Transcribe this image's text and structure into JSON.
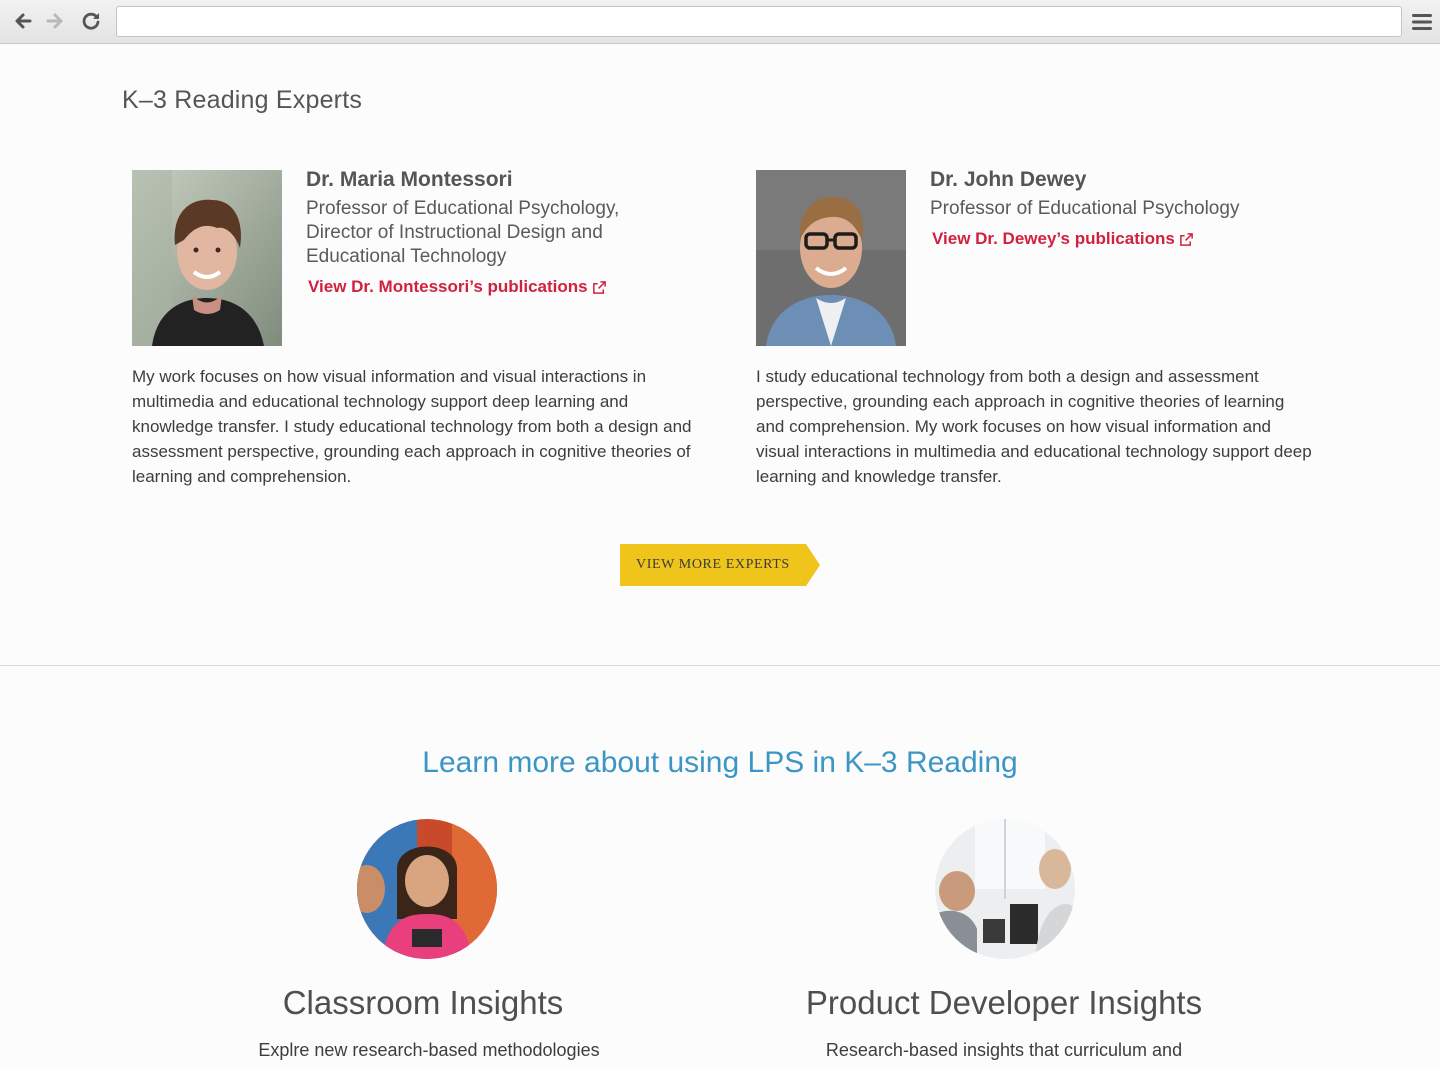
{
  "browser": {
    "url": ""
  },
  "section": {
    "title": "K–3 Reading Experts"
  },
  "experts": [
    {
      "name": "Dr. Maria Montessori",
      "title": "Professor of Educational Psychology, Director of Instructional Design and Educational Technology",
      "link": "View Dr. Montessori’s publications",
      "bio": "My work focuses on how visual information and visual interactions in multimedia and educational technology support deep learning and knowledge transfer. I study educational technology from both a design and assessment perspective, grounding each approach in cognitive theories of learning and comprehension."
    },
    {
      "name": "Dr. John Dewey",
      "title": "Professor of Educational Psychology",
      "link": "View Dr. Dewey’s publications",
      "bio": "I study educational technology from both a design and assessment perspective, grounding each approach in cognitive theories of learning and comprehension. My work focuses on how visual information and visual interactions in multimedia and educational technology support deep learning and knowledge transfer."
    }
  ],
  "more_button": {
    "label": "VIEW MORE EXPERTS"
  },
  "learn": {
    "heading": "Learn more about using LPS in K–3 Reading",
    "cards": [
      {
        "title": "Classroom Insights",
        "text": "Explre new research-based methodologies"
      },
      {
        "title": "Product Developer Insights",
        "text": "Research-based insights that curriculum and"
      }
    ]
  },
  "colors": {
    "accent_red": "#d0223e",
    "accent_blue": "#3b96c6",
    "button_yellow": "#f0c51b"
  }
}
